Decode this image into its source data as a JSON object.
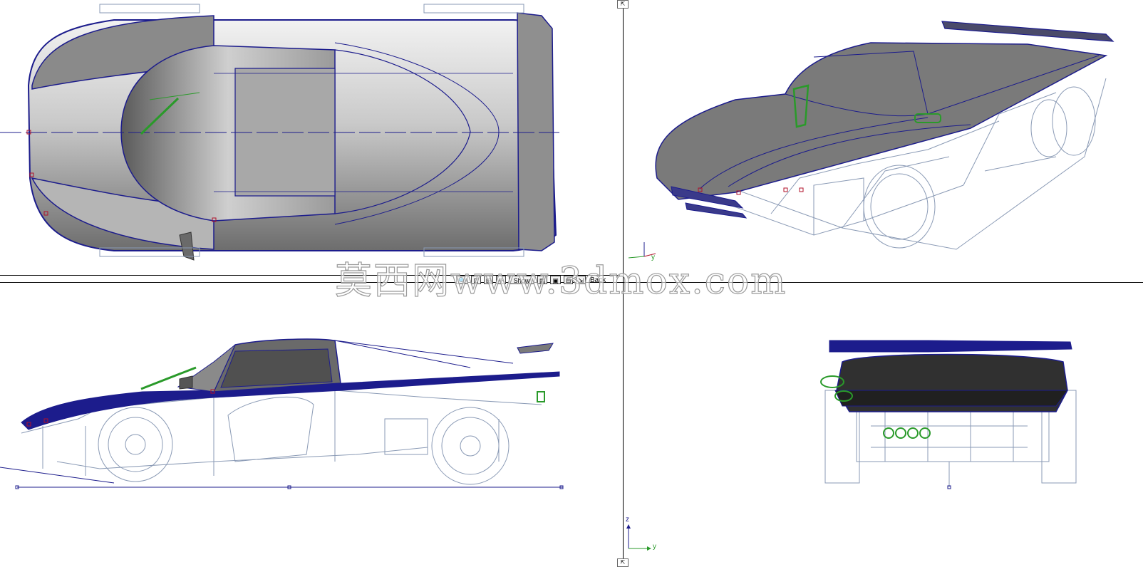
{
  "toolbar": {
    "show_label": "Show",
    "view_label": "Back",
    "zoom_icon": "magnifier-icon"
  },
  "watermark": {
    "text": "莫西网www.3dmox.com"
  },
  "viewports": {
    "top": {
      "name": "top"
    },
    "perspective": {
      "name": "perspective",
      "axis_y": "y"
    },
    "left": {
      "name": "left",
      "axis_z": "z",
      "axis_y": "y"
    },
    "back": {
      "name": "back"
    }
  },
  "colors": {
    "wire_blue": "#1c1c8c",
    "wire_grey": "#8a9ab5",
    "body_grey": "#7a7a7a",
    "select_red": "#b0102a",
    "select_green": "#2a9a2a"
  }
}
